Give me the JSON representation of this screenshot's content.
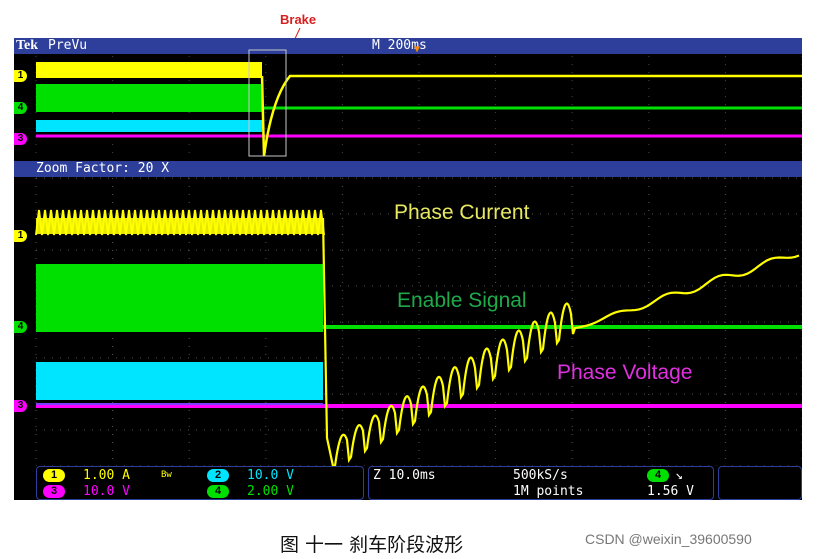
{
  "annotation": {
    "brake": "Brake"
  },
  "scope": {
    "brand": "Tek",
    "mode": "PreVu",
    "timebase": "M 200ms",
    "zoom_label": "Zoom Factor: 20 X"
  },
  "markers": {
    "ch1": "1",
    "ch4": "4",
    "ch3": "3"
  },
  "labels": {
    "phase_current": "Phase Current",
    "enable_signal": "Enable Signal",
    "phase_voltage": "Phase Voltage"
  },
  "status": {
    "ch1_badge": "1",
    "ch1_scale": "1.00 A",
    "bw": "Bw",
    "ch2_badge": "2",
    "ch2_scale": "10.0 V",
    "ch3_badge": "3",
    "ch3_scale": "10.0 V",
    "ch4_badge": "4",
    "ch4_scale": "2.00 V",
    "zoom_time": "Z 10.0ms",
    "sample_rate": "500kS/s",
    "record": "1M points",
    "trig_badge": "4",
    "trig_slope": "↘",
    "trig_level": "1.56 V"
  },
  "colors": {
    "ch1": "#ffff00",
    "ch4": "#00e000",
    "ch2": "#00e5ff",
    "ch3": "#ff00ff",
    "bar": "#2d3f9a",
    "annotation": "#d62020",
    "label_current": "#e8e860",
    "label_enable": "#1faa4a",
    "label_voltage": "#e030e0"
  },
  "caption": "图 十一 刹车阶段波形",
  "credit": "CSDN @weixin_39600590",
  "chart_data": {
    "type": "line",
    "title": "",
    "xlabel": "",
    "ylabel": "",
    "series": [
      {
        "name": "Phase Current",
        "channel": 1,
        "scale": "1.00 A/div",
        "description_points": {
          "x_frac": [
            0,
            0.375,
            0.385,
            0.42,
            0.5,
            0.6,
            0.7,
            0.8,
            0.9,
            1.0
          ],
          "y_div": [
            1.2,
            1.2,
            -2.8,
            -2.2,
            -1.5,
            -0.9,
            -0.3,
            0.1,
            0.5,
            0.9
          ]
        }
      },
      {
        "name": "Enable Signal",
        "channel": 4,
        "scale": "2.00 V/div"
      },
      {
        "name": "Phase Voltage",
        "channel": 3,
        "scale": "10.0 V/div"
      }
    ],
    "grid": true
  }
}
